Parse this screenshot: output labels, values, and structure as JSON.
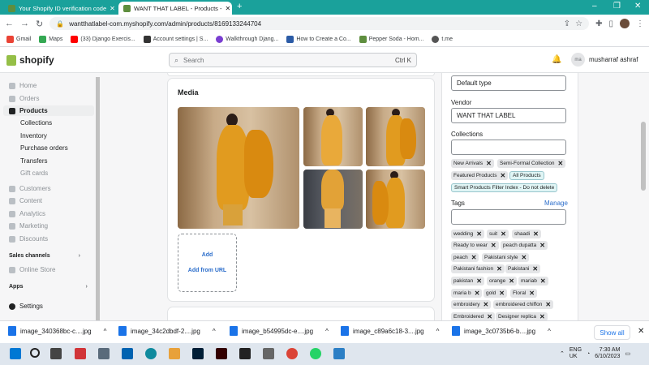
{
  "browser": {
    "tabs": [
      {
        "title": "Your Shopify ID verification code",
        "active": false
      },
      {
        "title": "WANT THAT LABEL - Products - ",
        "active": true
      }
    ],
    "url": "wantthatlabel-com.myshopify.com/admin/products/8169133244704",
    "bookmarks": [
      "Gmail",
      "Maps",
      "(33) Django Exercis...",
      "Account settings | S...",
      "Walkthrough Djang...",
      "How to Create a Co...",
      "Pepper Soda - Hom...",
      "t.me"
    ]
  },
  "shopify": {
    "logo": "shopify",
    "search_placeholder": "Search",
    "search_shortcut": "Ctrl K",
    "user_initials": "ma",
    "user_name": "musharraf ashraf"
  },
  "sidebar": {
    "home": "Home",
    "orders": "Orders",
    "products": "Products",
    "collections": "Collections",
    "inventory": "Inventory",
    "purchase_orders": "Purchase orders",
    "transfers": "Transfers",
    "gift_cards": "Gift cards",
    "customers": "Customers",
    "content": "Content",
    "analytics": "Analytics",
    "marketing": "Marketing",
    "discounts": "Discounts",
    "sales_channels": "Sales channels",
    "online_store": "Online Store",
    "apps": "Apps",
    "settings": "Settings"
  },
  "media": {
    "heading": "Media",
    "add_label": "Add",
    "add_url_label": "Add from URL"
  },
  "organization": {
    "product_type_value": "Default type",
    "vendor_label": "Vendor",
    "vendor_value": "WANT THAT LABEL",
    "collections_label": "Collections",
    "collections": [
      "New Arrivals",
      "Semi-Formal Collection",
      "Featured Products",
      "All Products",
      "Smart Products Filter Index - Do not delete"
    ],
    "tags_label": "Tags",
    "manage_label": "Manage",
    "tags": [
      "wedding",
      "suit",
      "shaadi",
      "Ready to wear",
      "peach dupatta",
      "peach",
      "Pakistani style",
      "Pakistani fashion",
      "Pakistani",
      "pakistan",
      "orange",
      "mariab",
      "maria b",
      "gold",
      "Floral",
      "embroidery",
      "embroidered chiffon",
      "Embroidered",
      "Designer replica"
    ]
  },
  "downloads": {
    "files": [
      "image_340368bc-c....jpg",
      "image_34c2dbdf-2....jpg",
      "image_b54995dc-e....jpg",
      "image_c89a6c18-3....jpg",
      "image_3c0735b6-b....jpg"
    ],
    "show_all": "Show all"
  },
  "taskbar": {
    "lang_top": "ENG",
    "lang_bottom": "UK",
    "time": "7:30 AM",
    "date": "6/10/2023"
  }
}
